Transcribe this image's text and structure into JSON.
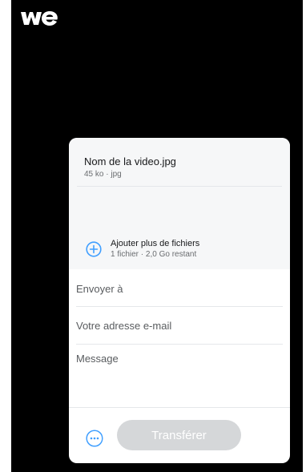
{
  "brand": {
    "logo_text": "we",
    "accent_color": "#409fff"
  },
  "files": {
    "items": [
      {
        "name": "Nom de la video.jpg",
        "meta": "45 ko · jpg"
      }
    ],
    "add_more_label": "Ajouter plus de fichiers",
    "summary": "1 fichier · 2,0 Go restant"
  },
  "form": {
    "send_to_placeholder": "Envoyer à",
    "email_placeholder": "Votre adresse e-mail",
    "message_placeholder": "Message"
  },
  "actions": {
    "transfer_label": "Transférer",
    "more_icon": "more-options-icon"
  }
}
